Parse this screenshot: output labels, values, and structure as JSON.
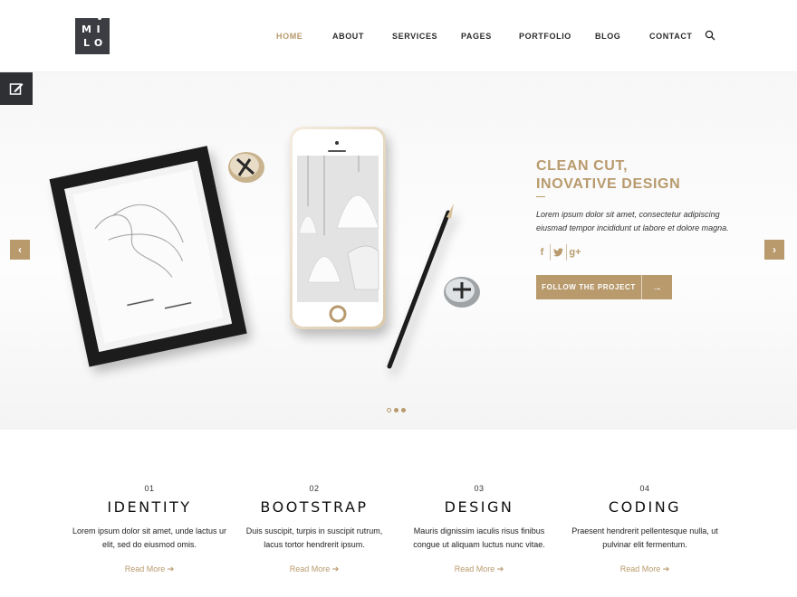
{
  "logo": {
    "letters": [
      "M",
      "I",
      "L",
      "O"
    ]
  },
  "nav": {
    "items": [
      {
        "label": "HOME",
        "active": true
      },
      {
        "label": "ABOUT",
        "active": false
      },
      {
        "label": "SERVICES",
        "active": false
      },
      {
        "label": "PAGES",
        "active": false
      },
      {
        "label": "PORTFOLIO",
        "active": false
      },
      {
        "label": "BLOG",
        "active": false
      },
      {
        "label": "CONTACT",
        "active": false
      }
    ],
    "search_icon": "search-icon"
  },
  "edit_icon": "edit-icon",
  "hero": {
    "title_line1": "CLEAN CUT,",
    "title_line2": "INOVATIVE DESIGN",
    "text": "Lorem ipsum dolor sit amet, consectetur adipiscing eiusmad tempor incididunt ut labore et dolore magna.",
    "socials": [
      "f",
      "t",
      "g+"
    ],
    "button_label": "FOLLOW THE PROJECT",
    "button_icon": "→",
    "prev_arrow": "‹",
    "next_arrow": "›",
    "slides": 3,
    "active_slide": 2
  },
  "features": [
    {
      "num": "01",
      "title": "IDENTITY",
      "text": "Lorem ipsum dolor sit amet, unde lactus ur elit, sed do eiusmod omis.",
      "link": "Read More ➔"
    },
    {
      "num": "02",
      "title": "BOOTSTRAP",
      "text": "Duis suscipit, turpis in suscipit rutrum, lacus tortor hendrerit ipsum.",
      "link": "Read More ➔"
    },
    {
      "num": "03",
      "title": "DESIGN",
      "text": "Mauris dignissim iaculis risus finibus congue ut aliquam luctus nunc vitae.",
      "link": "Read More ➔"
    },
    {
      "num": "04",
      "title": "CODING",
      "text": "Praesent hendrerit pellentesque nulla, ut pulvinar elit fermentum.",
      "link": "Read More ➔"
    }
  ],
  "colors": {
    "accent": "#b89a6d",
    "dark": "#3c3d42"
  }
}
